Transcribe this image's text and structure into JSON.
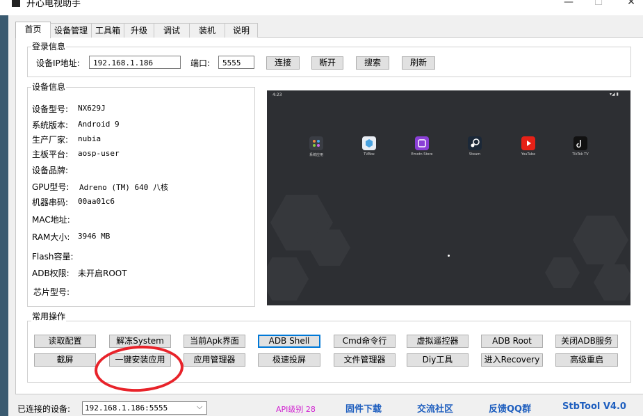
{
  "window": {
    "title": "开心电视助手",
    "minimize": "—",
    "maximize": "☐",
    "close": "✕"
  },
  "tabs": [
    "首页",
    "设备管理",
    "工具箱",
    "升级",
    "调试",
    "装机",
    "说明"
  ],
  "login": {
    "group_title": "登录信息",
    "ip_label": "设备IP地址:",
    "ip_value": "192.168.1.186",
    "port_label": "端口:",
    "port_value": "5555",
    "buttons": [
      "连接",
      "断开",
      "搜索",
      "刷新"
    ]
  },
  "device_info": {
    "group_title": "设备信息",
    "fields": [
      {
        "label": "设备型号:",
        "value": "NX629J"
      },
      {
        "label": "系统版本:",
        "value": "Android 9"
      },
      {
        "label": "生产厂家:",
        "value": "nubia"
      },
      {
        "label": "主板平台:",
        "value": "aosp-user"
      },
      {
        "label": "设备品牌:",
        "value": ""
      },
      {
        "label": "GPU型号:",
        "value": "Adreno (TM) 640 八核"
      },
      {
        "label": "机器串码:",
        "value": "00aa01c6"
      },
      {
        "label": "MAC地址:",
        "value": ""
      },
      {
        "label": "RAM大小:",
        "value": "3946 MB"
      },
      {
        "label": "Flash容量:",
        "value": ""
      },
      {
        "label": "ADB权限:",
        "value": "未开启ROOT"
      },
      {
        "label": "芯片型号:",
        "value": ""
      }
    ]
  },
  "screen_preview": {
    "time": "4:23",
    "status_icons": "▾◢ ▮",
    "apps": [
      {
        "name": "系统应用",
        "color": "#3a3d44"
      },
      {
        "name": "TVBox",
        "color": "#e9eef5"
      },
      {
        "name": "Emotn Store",
        "color": "#8a3fd6"
      },
      {
        "name": "Steam",
        "color": "#1b2838"
      },
      {
        "name": "YouTube",
        "color": "#e62117"
      },
      {
        "name": "TikTok TV",
        "color": "#111111"
      }
    ]
  },
  "operations": {
    "group_title": "常用操作",
    "row1": [
      "读取配置",
      "解冻System",
      "当前Apk界面",
      "ADB Shell",
      "Cmd命令行",
      "虚拟遥控器",
      "ADB  Root",
      "关闭ADB服务"
    ],
    "row2": [
      "截屏",
      "一键安装应用",
      "应用管理器",
      "极速投屏",
      "文件管理器",
      "Diy工具",
      "进入Recovery",
      "高级重启"
    ]
  },
  "statusbar": {
    "connected_label": "已连接的设备:",
    "device_select": "192.168.1.186:5555",
    "api_level": "API级别 28",
    "firmware_link": "固件下载",
    "community_link": "交流社区",
    "feedback_link": "反馈QQ群",
    "version": "StbTool V4.0"
  },
  "colors": {
    "accent": "#0078d7",
    "link": "#1f5fbf",
    "api_text": "#d01fd0",
    "annotation_red": "#e8232a"
  }
}
